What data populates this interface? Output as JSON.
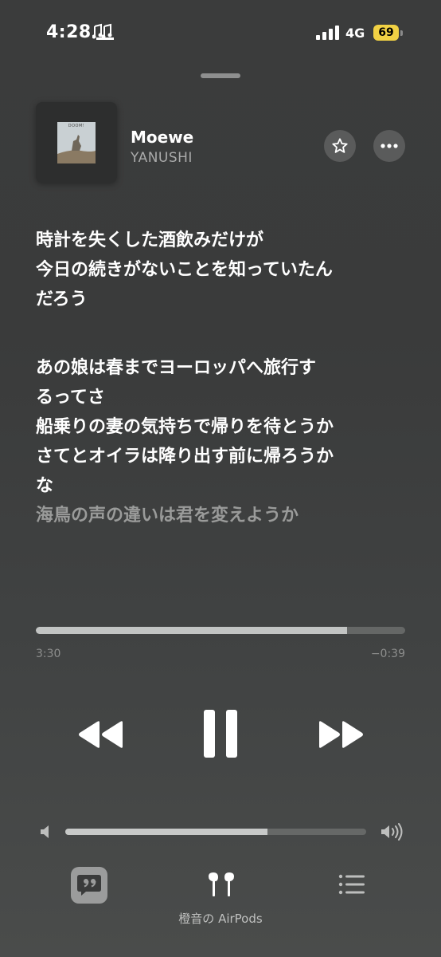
{
  "status_bar": {
    "time": "4:28",
    "network": "4G",
    "battery": "69",
    "icons": [
      "music-note-icon",
      "cellular-signal-icon",
      "battery-icon"
    ]
  },
  "now_playing": {
    "artwork_text": "DOOM!",
    "title": "Moewe",
    "artist": "YANUSHI",
    "buttons": [
      "favorite-star-icon",
      "more-ellipsis-icon"
    ]
  },
  "lyrics": {
    "stanza1": [
      "時計を失くした酒飲みだけが",
      "今日の続きがないことを知っていたん",
      "だろう"
    ],
    "stanza2": [
      "あの娘は春までヨーロッパへ旅行す",
      "るってさ",
      "船乗りの妻の気持ちで帰りを待とうか",
      "さてとオイラは降り出す前に帰ろうか",
      "な"
    ],
    "upcoming": "海鳥の声の違いは君を変えようか"
  },
  "progress": {
    "elapsed": "3:30",
    "remaining": "−0:39",
    "fraction": 0.843
  },
  "controls": {
    "icons": [
      "rewind-icon",
      "pause-icon",
      "fast-forward-icon"
    ]
  },
  "volume": {
    "fraction": 0.672,
    "icons": [
      "volume-low-icon",
      "volume-high-icon"
    ]
  },
  "bottom_bar": {
    "airplay_label": "橙音の AirPods",
    "icons": [
      "lyrics-quote-icon",
      "airpods-icon",
      "queue-list-icon"
    ]
  },
  "colors": {
    "background": "#3b3c3c",
    "battery": "#f1d144",
    "lyric_active": "#ffffff",
    "lyric_dim": "#9a9b9a"
  }
}
